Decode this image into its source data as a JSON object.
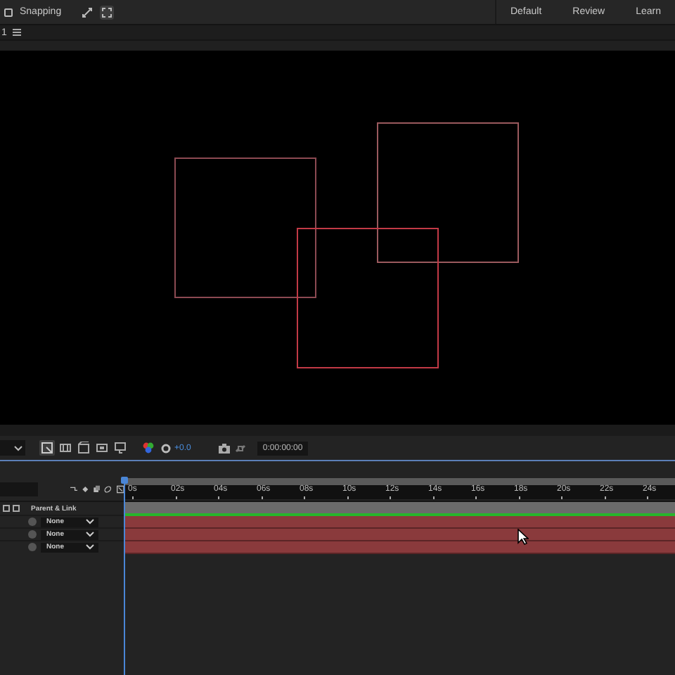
{
  "top_bar": {
    "snapping": {
      "label": "Snapping",
      "checked": false
    },
    "workspaces": [
      {
        "label": "Default",
        "selected": false
      },
      {
        "label": "Review",
        "selected": false
      },
      {
        "label": "Learn",
        "selected": false
      }
    ]
  },
  "viewer": {
    "tab_label": "1",
    "shapes": [
      {
        "color": "#8c4a52"
      },
      {
        "color": "#9a5a5e"
      },
      {
        "color": "#c23a46"
      }
    ]
  },
  "toolbar": {
    "exposure": "+0.0",
    "timecode": "0:00:00:00"
  },
  "timeline": {
    "column_header": "Parent & Link",
    "ruler": [
      "0s",
      "02s",
      "04s",
      "06s",
      "08s",
      "10s",
      "12s",
      "14s",
      "16s",
      "18s",
      "20s",
      "22s",
      "24s"
    ],
    "layers": [
      {
        "parent": "None"
      },
      {
        "parent": "None"
      },
      {
        "parent": "None"
      }
    ]
  }
}
